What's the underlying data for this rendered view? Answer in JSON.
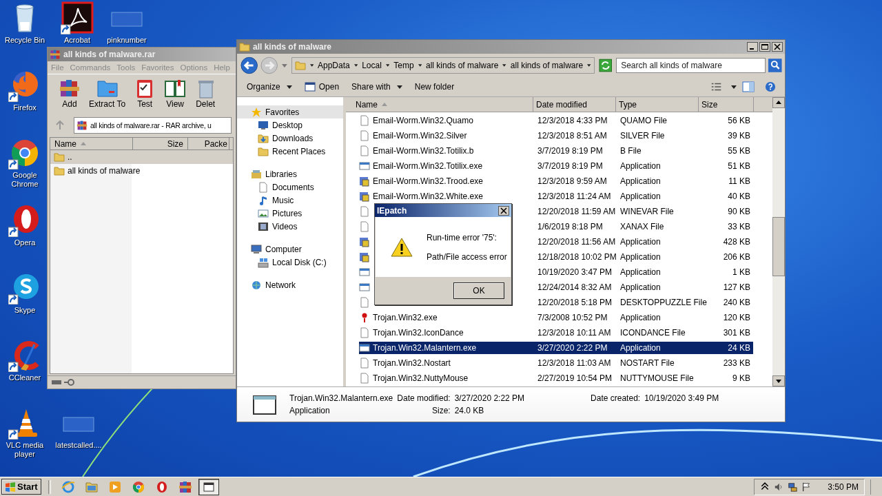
{
  "desktop_icons": [
    {
      "kind": "recycle",
      "label": "Recycle Bin"
    },
    {
      "kind": "acrobat",
      "label": "Acrobat"
    },
    {
      "kind": "blank",
      "label": "pinknumber"
    },
    {
      "kind": "firefox",
      "label": "Firefox"
    },
    {
      "kind": "chrome",
      "label": "Google Chrome"
    },
    {
      "kind": "opera",
      "label": "Opera"
    },
    {
      "kind": "skype",
      "label": "Skype"
    },
    {
      "kind": "ccleaner",
      "label": "CCleaner"
    },
    {
      "kind": "vlc",
      "label": "VLC media player"
    },
    {
      "kind": "blank",
      "label": "latestcalled...."
    }
  ],
  "winrar": {
    "title": "all kinds of malware.rar",
    "menu": [
      "File",
      "Commands",
      "Tools",
      "Favorites",
      "Options",
      "Help"
    ],
    "toolbar": [
      {
        "kind": "add",
        "label": "Add"
      },
      {
        "kind": "extract",
        "label": "Extract To"
      },
      {
        "kind": "test",
        "label": "Test"
      },
      {
        "kind": "view",
        "label": "View"
      },
      {
        "kind": "delete",
        "label": "Delet"
      }
    ],
    "address": "all kinds of malware.rar - RAR archive, u",
    "columns": [
      {
        "label": "Name",
        "sorted": true
      },
      {
        "label": "Size",
        "sorted": false
      },
      {
        "label": "Packe",
        "sorted": false
      }
    ],
    "rows": [
      {
        "name": "..",
        "selected": true
      },
      {
        "name": "all kinds of malware",
        "selected": false
      }
    ]
  },
  "explorer": {
    "title": "all kinds of malware",
    "breadcrumb": [
      "AppData",
      "Local",
      "Temp",
      "all kinds of malware",
      "all kinds of malware"
    ],
    "search": {
      "placeholder": "Search all kinds of malware"
    },
    "toolbar": [
      {
        "label": "Organize",
        "icon": false,
        "dropdown": true
      },
      {
        "label": "Open",
        "icon": true,
        "dropdown": false
      },
      {
        "label": "Share with",
        "icon": false,
        "dropdown": true
      },
      {
        "label": "New folder",
        "icon": false,
        "dropdown": false
      }
    ],
    "navigation": [
      {
        "label": "Favorites",
        "kind": "star",
        "children": [
          {
            "label": "Desktop",
            "kind": "desktop"
          },
          {
            "label": "Downloads",
            "kind": "downloads"
          },
          {
            "label": "Recent Places",
            "kind": "recent"
          }
        ]
      },
      {
        "label": "Libraries",
        "kind": "library",
        "children": [
          {
            "label": "Documents",
            "kind": "documents"
          },
          {
            "label": "Music",
            "kind": "music"
          },
          {
            "label": "Pictures",
            "kind": "pictures"
          },
          {
            "label": "Videos",
            "kind": "videos"
          }
        ]
      },
      {
        "label": "Computer",
        "kind": "computer",
        "children": [
          {
            "label": "Local Disk (C:)",
            "kind": "disk"
          }
        ]
      },
      {
        "label": "Network",
        "kind": "network"
      }
    ],
    "columns": [
      {
        "label": "Name",
        "sorted": true
      },
      {
        "label": "Date modified",
        "sorted": false
      },
      {
        "label": "Type",
        "sorted": false
      },
      {
        "label": "Size",
        "sorted": false
      }
    ],
    "rows": [
      {
        "kind": "doc",
        "name": "Email-Worm.Win32.Quamo",
        "date": "12/3/2018 4:33 PM",
        "type": "QUAMO File",
        "size": "56 KB",
        "selected": false
      },
      {
        "kind": "doc",
        "name": "Email-Worm.Win32.Silver",
        "date": "12/3/2018 8:51 AM",
        "type": "SILVER File",
        "size": "39 KB",
        "selected": false
      },
      {
        "kind": "doc",
        "name": "Email-Worm.Win32.Totilix.b",
        "date": "3/7/2019 8:19 PM",
        "type": "B File",
        "size": "55 KB",
        "selected": false
      },
      {
        "kind": "app",
        "name": "Email-Worm.Win32.Totilix.exe",
        "date": "3/7/2019 8:19 PM",
        "type": "Application",
        "size": "51 KB",
        "selected": false
      },
      {
        "kind": "prog",
        "name": "Email-Worm.Win32.Trood.exe",
        "date": "12/3/2018 9:59 AM",
        "type": "Application",
        "size": "11 KB",
        "selected": false
      },
      {
        "kind": "prog",
        "name": "Email-Worm.Win32.White.exe",
        "date": "12/3/2018 11:24 AM",
        "type": "Application",
        "size": "40 KB",
        "selected": false
      },
      {
        "kind": "doc",
        "date": "12/20/2018 11:59 AM",
        "type": "WINEVAR File",
        "size": "90 KB",
        "selected": false
      },
      {
        "kind": "doc",
        "date": "1/6/2019 8:18 PM",
        "type": "XANAX File",
        "size": "33 KB",
        "selected": false
      },
      {
        "kind": "prog",
        "date": "12/20/2018 11:56 AM",
        "type": "Application",
        "size": "428 KB",
        "selected": false
      },
      {
        "kind": "prog",
        "date": "12/18/2018 10:02 PM",
        "type": "Application",
        "size": "206 KB",
        "selected": false
      },
      {
        "kind": "app",
        "date": "10/19/2020 3:47 PM",
        "type": "Application",
        "size": "1 KB",
        "selected": false
      },
      {
        "kind": "app",
        "date": "12/24/2014 8:32 AM",
        "type": "Application",
        "size": "127 KB",
        "selected": false
      },
      {
        "kind": "doc",
        "date": "12/20/2018 5:18 PM",
        "type": "DESKTOPPUZZLE File",
        "size": "240 KB",
        "selected": false
      },
      {
        "kind": "exclaim",
        "name": "Trojan.Win32.exe",
        "date": "7/3/2008 10:52 PM",
        "type": "Application",
        "size": "120 KB",
        "selected": false
      },
      {
        "kind": "doc",
        "name": "Trojan.Win32.IconDance",
        "date": "12/3/2018 10:11 AM",
        "type": "ICONDANCE File",
        "size": "301 KB",
        "selected": false
      },
      {
        "kind": "app",
        "name": "Trojan.Win32.Malantern.exe",
        "date": "3/27/2020 2:22 PM",
        "type": "Application",
        "size": "24 KB",
        "selected": true
      },
      {
        "kind": "doc",
        "name": "Trojan.Win32.Nostart",
        "date": "12/3/2018 11:03 AM",
        "type": "NOSTART File",
        "size": "233 KB",
        "selected": false
      },
      {
        "kind": "doc",
        "name": "Trojan.Win32.NuttyMouse",
        "date": "2/27/2019 10:54 PM",
        "type": "NUTTYMOUSE File",
        "size": "9 KB",
        "selected": false
      }
    ],
    "details": {
      "name": "Trojan.Win32.Malantern.exe",
      "type": "Application",
      "modified_label": "Date modified:",
      "modified": "3/27/2020 2:22 PM",
      "size_label": "Size:",
      "size": "24.0 KB",
      "created_label": "Date created:",
      "created": "10/19/2020 3:49 PM"
    }
  },
  "dialog": {
    "title": "IEpatch",
    "lines": [
      "Run-time error '75':",
      "Path/File access error"
    ],
    "button": "OK"
  },
  "taskbar": {
    "start": "Start",
    "apps": [
      {
        "kind": "ie",
        "active": false
      },
      {
        "kind": "folder",
        "active": false
      },
      {
        "kind": "media",
        "active": false
      },
      {
        "kind": "chrome",
        "active": false
      },
      {
        "kind": "opera",
        "active": false
      },
      {
        "kind": "winrar",
        "active": false
      },
      {
        "kind": "window",
        "active": true
      }
    ],
    "clock": "3:50 PM"
  }
}
